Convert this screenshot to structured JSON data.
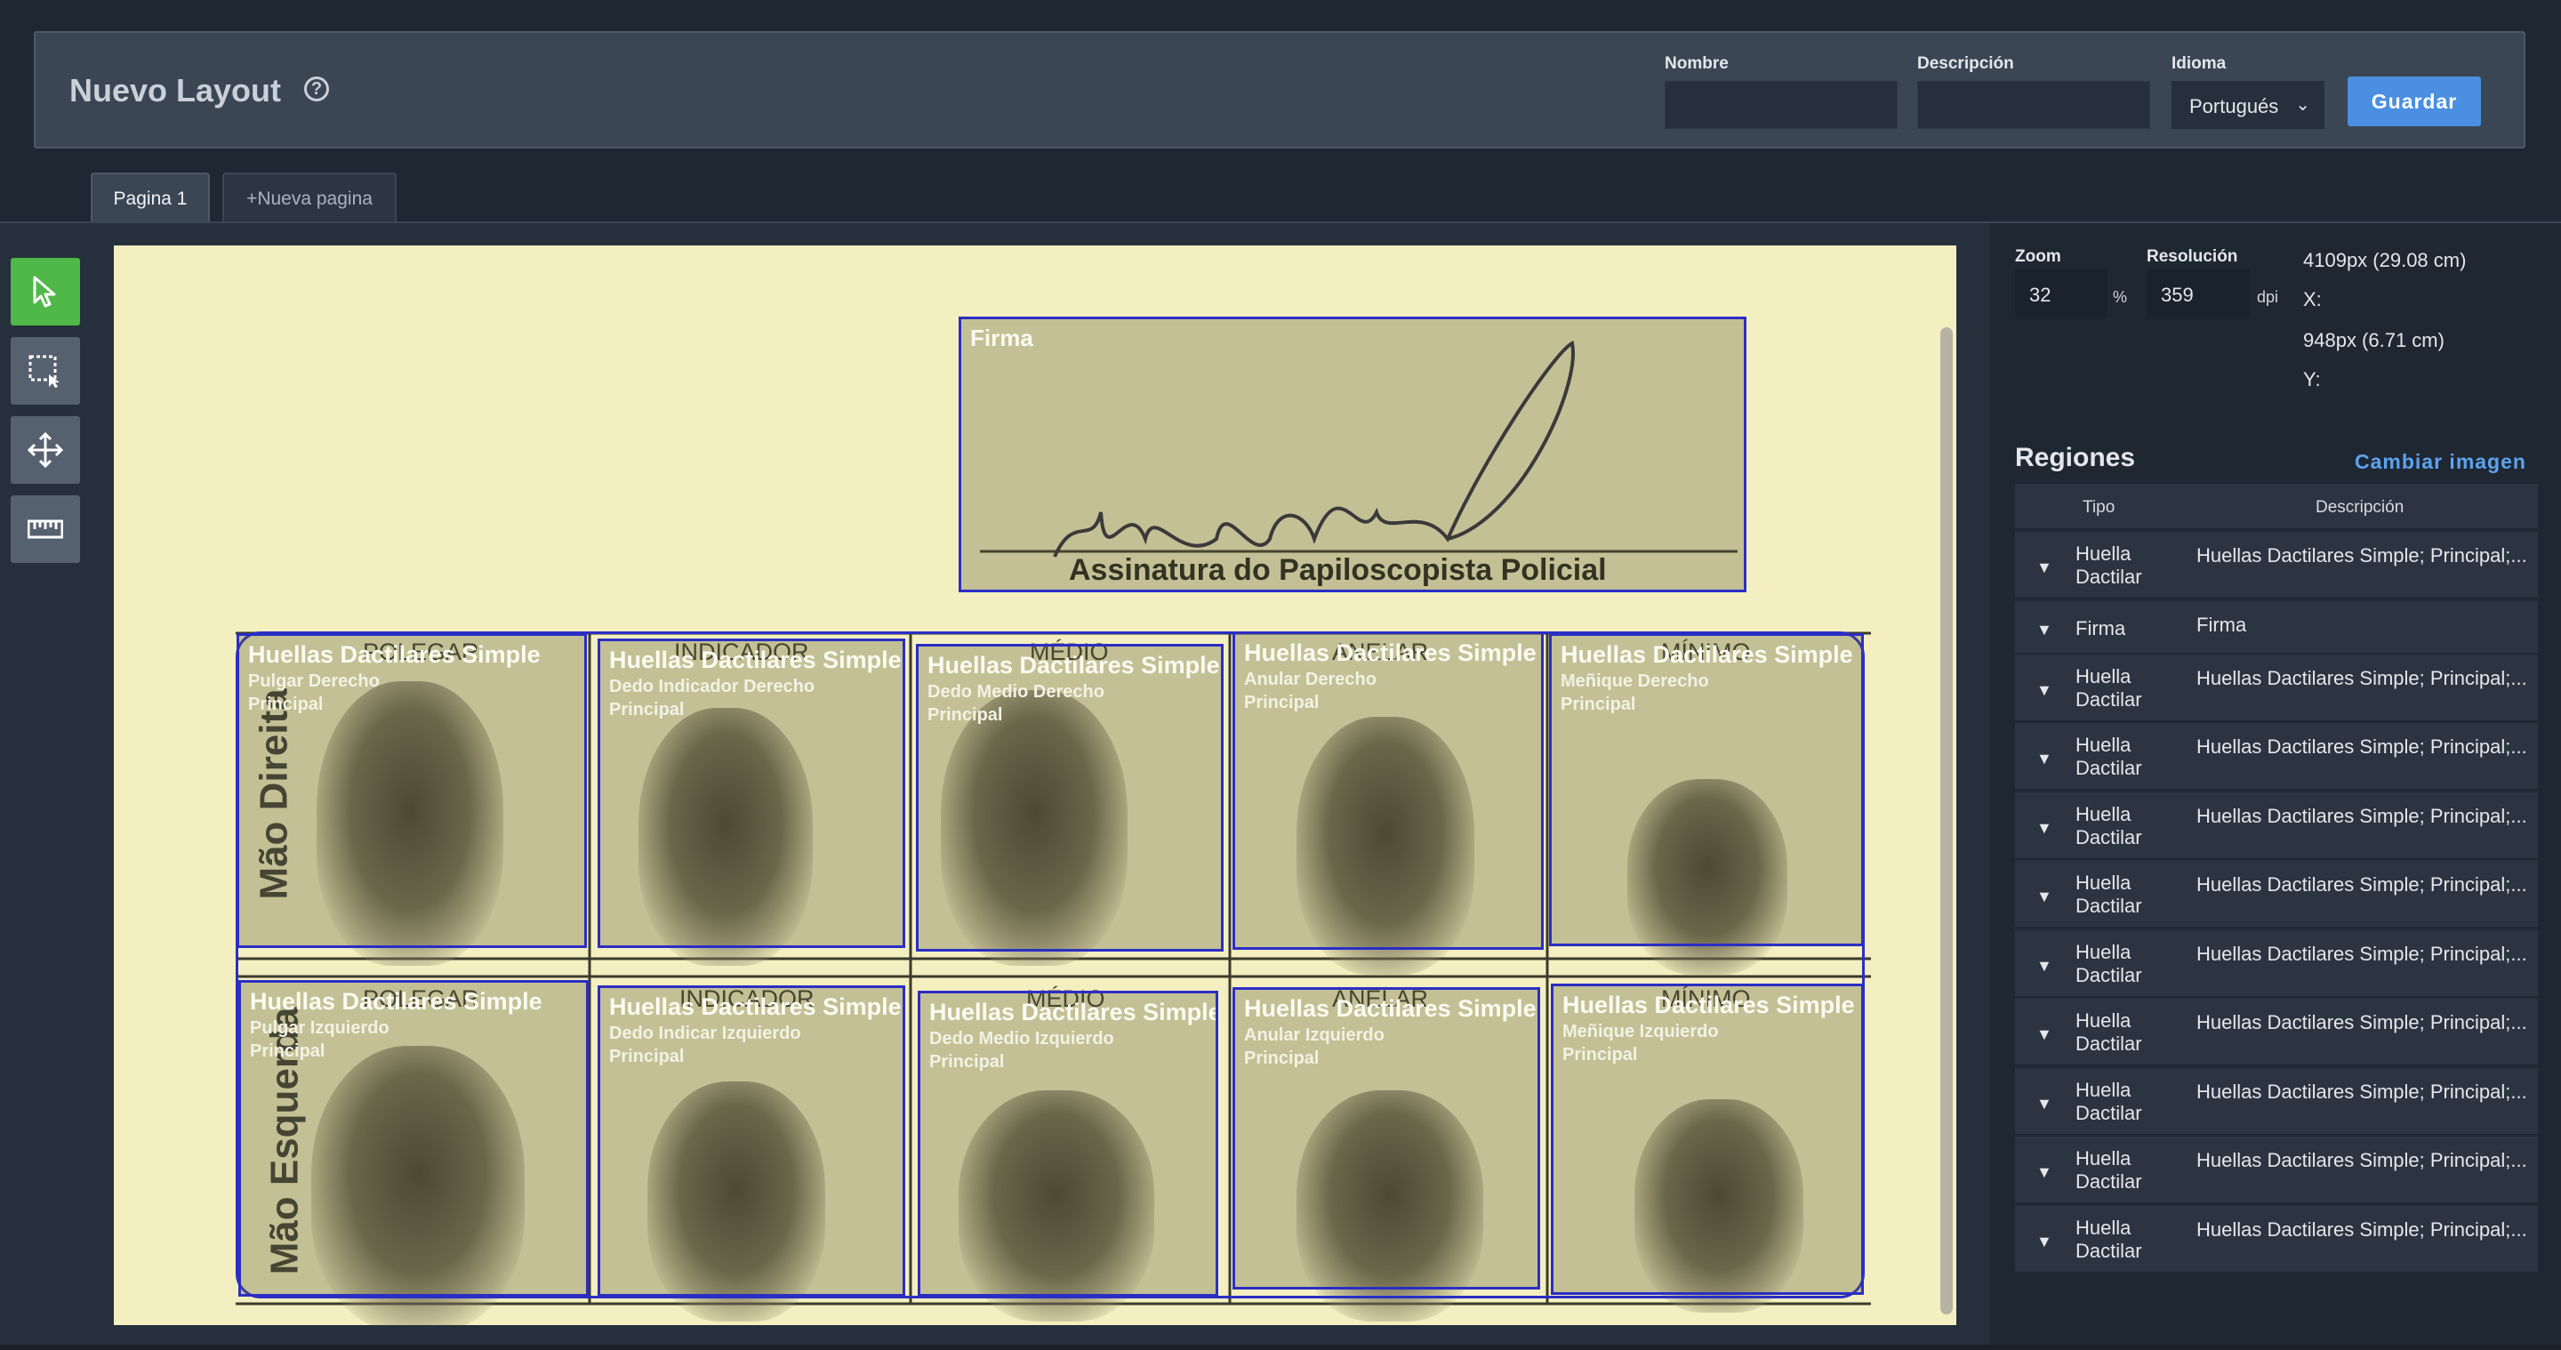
{
  "header": {
    "title": "Nuevo Layout",
    "nombre_label": "Nombre",
    "nombre_value": "",
    "descripcion_label": "Descripción",
    "descripcion_value": "",
    "idioma_label": "Idioma",
    "idioma_value": "Portugués",
    "save_label": "Guardar"
  },
  "tabs": [
    {
      "label": "Pagina 1",
      "active": true
    },
    {
      "label": "+Nueva pagina",
      "active": false
    }
  ],
  "tools": [
    "select-pointer-icon",
    "rect-select-icon",
    "move-icon",
    "ruler-icon"
  ],
  "canvas": {
    "signature_region": {
      "title": "Firma"
    },
    "signature_caption": "Assinatura do Papiloscopista Policial",
    "form_headers_right": [
      "POLEGAR",
      "INDICADOR",
      "MÉDIO",
      "ANELAR",
      "MÍNIMO"
    ],
    "form_headers_left": [
      "POLEGAR",
      "INDICADOR",
      "MÉDIO",
      "ANELAR",
      "MÍNIMO"
    ],
    "row_right_label": "Mão Direita",
    "row_left_label": "Mão Esquerda",
    "regions_right": [
      {
        "title": "Huellas Dactilares Simple",
        "finger": "Pulgar Derecho",
        "role": "Principal"
      },
      {
        "title": "Huellas Dactilares Simple",
        "finger": "Dedo Indicador Derecho",
        "role": "Principal"
      },
      {
        "title": "Huellas Dactilares Simple",
        "finger": "Dedo Medio Derecho",
        "role": "Principal"
      },
      {
        "title": "Huellas Dactilares Simple",
        "finger": "Anular Derecho",
        "role": "Principal"
      },
      {
        "title": "Huellas Dactilares Simple",
        "finger": "Meñique Derecho",
        "role": "Principal"
      }
    ],
    "regions_left": [
      {
        "title": "Huellas Dactilares Simple",
        "finger": "Pulgar Izquierdo",
        "role": "Principal"
      },
      {
        "title": "Huellas Dactilares Simple",
        "finger": "Dedo Indicar Izquierdo",
        "role": "Principal"
      },
      {
        "title": "Huellas Dactilares Simple",
        "finger": "Dedo Medio Izquierdo",
        "role": "Principal"
      },
      {
        "title": "Huellas Dactilares Simple",
        "finger": "Anular Izquierdo",
        "role": "Principal"
      },
      {
        "title": "Huellas Dactilares Simple",
        "finger": "Meñique Izquierdo",
        "role": "Principal"
      }
    ]
  },
  "panel": {
    "zoom_label": "Zoom",
    "zoom_value": "32",
    "zoom_unit": "%",
    "resolution_label": "Resolución",
    "resolution_value": "359",
    "resolution_unit": "dpi",
    "x_value": "4109px (29.08 cm)",
    "x_label": "X:",
    "y_value": "948px (6.71 cm)",
    "y_label": "Y:",
    "regions_title": "Regiones",
    "change_image": "Cambiar imagen",
    "columns": [
      "Tipo",
      "Descripción"
    ],
    "rows": [
      {
        "tipo": "Huella Dactilar",
        "descripcion": "Huellas Dactilares Simple; Principal;..."
      },
      {
        "tipo": "Firma",
        "descripcion": "Firma"
      },
      {
        "tipo": "Huella Dactilar",
        "descripcion": "Huellas Dactilares Simple; Principal;..."
      },
      {
        "tipo": "Huella Dactilar",
        "descripcion": "Huellas Dactilares Simple; Principal;..."
      },
      {
        "tipo": "Huella Dactilar",
        "descripcion": "Huellas Dactilares Simple; Principal;..."
      },
      {
        "tipo": "Huella Dactilar",
        "descripcion": "Huellas Dactilares Simple; Principal;..."
      },
      {
        "tipo": "Huella Dactilar",
        "descripcion": "Huellas Dactilares Simple; Principal;..."
      },
      {
        "tipo": "Huella Dactilar",
        "descripcion": "Huellas Dactilares Simple; Principal;..."
      },
      {
        "tipo": "Huella Dactilar",
        "descripcion": "Huellas Dactilares Simple; Principal;..."
      },
      {
        "tipo": "Huella Dactilar",
        "descripcion": "Huellas Dactilares Simple; Principal;..."
      },
      {
        "tipo": "Huella Dactilar",
        "descripcion": "Huellas Dactilares Simple; Principal;..."
      }
    ]
  },
  "colors": {
    "accent": "#4a8fe0",
    "active_tool": "#4fb848",
    "region_border": "#2b2ec4",
    "canvas_paper": "#f4efc0"
  }
}
